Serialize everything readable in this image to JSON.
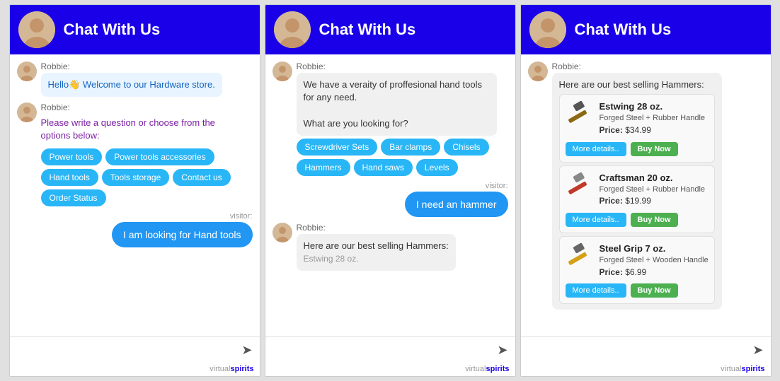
{
  "panels": [
    {
      "id": "panel1",
      "header": {
        "title": "Chat With Us"
      },
      "messages": [
        {
          "type": "bot",
          "sender": "Robbie:",
          "bubbleClass": "welcome",
          "text": "Hello👋 Welcome to our Hardware store."
        },
        {
          "type": "bot",
          "sender": "Robbie:",
          "bubbleClass": "purple-text",
          "text": "Please write a question or choose from the options below:",
          "options": [
            "Power tools",
            "Power tools accessories",
            "Hand tools",
            "Tools storage",
            "Contact us",
            "Order Status"
          ]
        },
        {
          "type": "visitor",
          "visitorLabel": "visitor:",
          "text": "I am looking for Hand tools"
        }
      ],
      "input_placeholder": "",
      "brand_virtual": "virtual",
      "brand_spirits": "spirits"
    },
    {
      "id": "panel2",
      "header": {
        "title": "Chat With Us"
      },
      "messages": [
        {
          "type": "bot",
          "sender": "Robbie:",
          "bubbleClass": "",
          "text": "We have a veraity of proffesional hand tools for any need.\n\nWhat are you looking for?",
          "options": [
            "Screwdriver Sets",
            "Bar clamps",
            "Chisels",
            "Hammers",
            "Hand saws",
            "Levels"
          ]
        },
        {
          "type": "visitor",
          "visitorLabel": "visitor:",
          "text": "I need an hammer"
        },
        {
          "type": "bot",
          "sender": "Robbie:",
          "bubbleClass": "",
          "text": "Here are our best selling Hammers:",
          "partial": true
        }
      ],
      "input_placeholder": "",
      "brand_virtual": "virtual",
      "brand_spirits": "spirits"
    },
    {
      "id": "panel3",
      "header": {
        "title": "Chat With Us"
      },
      "messages": [
        {
          "type": "bot",
          "sender": "Robbie:",
          "bubbleClass": "",
          "text": "Here are our best selling Hammers:",
          "products": [
            {
              "name": "Estwing 28 oz.",
              "desc": "Forged Steel + Rubber Handle",
              "price": "$34.99"
            },
            {
              "name": "Craftsman 20 oz.",
              "desc": "Forged Steel + Rubber Handle",
              "price": "$19.99"
            },
            {
              "name": "Steel Grip 7 oz.",
              "desc": "Forged Steel + Wooden Handle",
              "price": "$6.99"
            }
          ]
        }
      ],
      "input_placeholder": "",
      "brand_virtual": "virtual",
      "brand_spirits": "spirits"
    }
  ],
  "buttons": {
    "more_details": "More details..",
    "buy_now": "Buy Now"
  }
}
